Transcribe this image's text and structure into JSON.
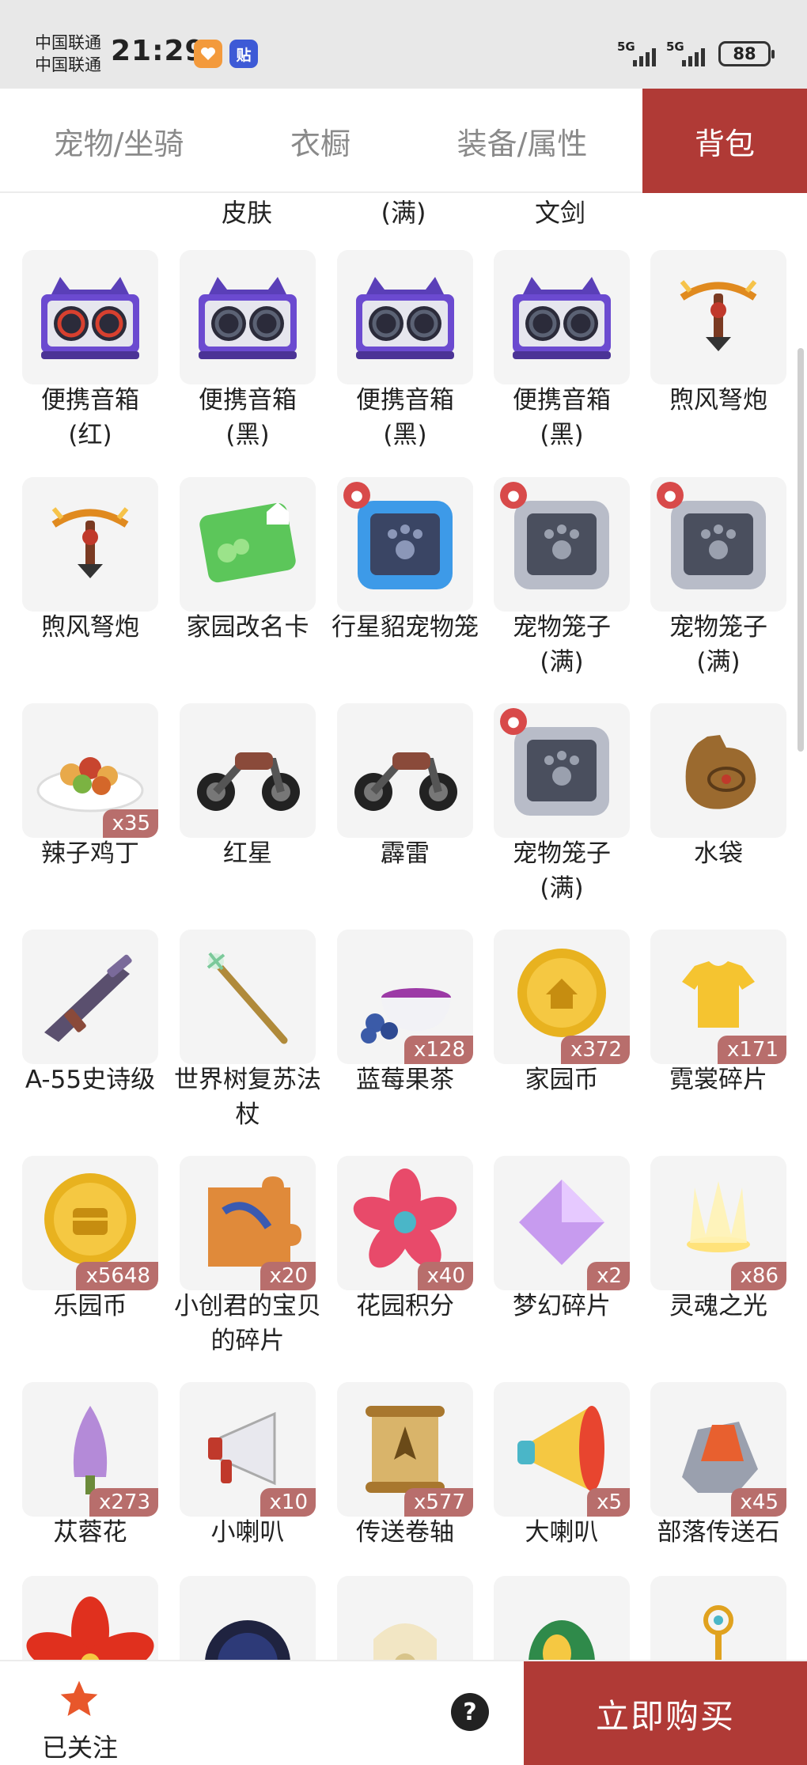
{
  "status_bar": {
    "carrier_1": "中国联通",
    "carrier_2": "中国联通",
    "time": "21:29",
    "app_badge_2": "贴",
    "signal_1": "5G",
    "signal_2": "5G",
    "battery": "88"
  },
  "tabs": [
    {
      "label": "宠物/坐骑",
      "active": false
    },
    {
      "label": "衣橱",
      "active": false
    },
    {
      "label": "装备/属性",
      "active": false
    },
    {
      "label": "背包",
      "active": true
    }
  ],
  "partial_labels": [
    "皮肤",
    "(满)",
    "文剑"
  ],
  "items": [
    {
      "name": "便携音箱\n(红)",
      "qty": "",
      "icon": "speaker-red-icon"
    },
    {
      "name": "便携音箱\n(黑)",
      "qty": "",
      "icon": "speaker-black-icon"
    },
    {
      "name": "便携音箱\n(黑)",
      "qty": "",
      "icon": "speaker-black-icon"
    },
    {
      "name": "便携音箱\n(黑)",
      "qty": "",
      "icon": "speaker-black-icon"
    },
    {
      "name": "煦风弩炮",
      "qty": "",
      "icon": "crossbow-icon"
    },
    {
      "name": "煦风弩炮",
      "qty": "",
      "icon": "crossbow-icon"
    },
    {
      "name": "家园改名卡",
      "qty": "",
      "icon": "rename-card-icon"
    },
    {
      "name": "行星貂宠物笼",
      "qty": "",
      "icon": "pet-cage-blue-icon"
    },
    {
      "name": "宠物笼子\n(满)",
      "qty": "",
      "icon": "pet-cage-grey-icon"
    },
    {
      "name": "宠物笼子\n(满)",
      "qty": "",
      "icon": "pet-cage-grey-icon"
    },
    {
      "name": "辣子鸡丁",
      "qty": "x35",
      "icon": "dish-icon"
    },
    {
      "name": "红星",
      "qty": "",
      "icon": "motorcycle-icon"
    },
    {
      "name": "霹雷",
      "qty": "",
      "icon": "motorcycle-icon"
    },
    {
      "name": "宠物笼子\n(满)",
      "qty": "",
      "icon": "pet-cage-grey-icon"
    },
    {
      "name": "水袋",
      "qty": "",
      "icon": "water-bag-icon"
    },
    {
      "name": "A-55史诗级",
      "qty": "",
      "icon": "rifle-icon"
    },
    {
      "name": "世界树复苏法杖",
      "qty": "",
      "icon": "staff-icon"
    },
    {
      "name": "蓝莓果茶",
      "qty": "x128",
      "icon": "tea-cup-icon"
    },
    {
      "name": "家园币",
      "qty": "x372",
      "icon": "home-coin-icon"
    },
    {
      "name": "霓裳碎片",
      "qty": "x171",
      "icon": "shirt-shard-icon"
    },
    {
      "name": "乐园币",
      "qty": "x5648",
      "icon": "park-coin-icon"
    },
    {
      "name": "小创君的宝贝的碎片",
      "qty": "x20",
      "icon": "puzzle-piece-icon"
    },
    {
      "name": "花园积分",
      "qty": "x40",
      "icon": "flower-badge-icon"
    },
    {
      "name": "梦幻碎片",
      "qty": "x2",
      "icon": "dream-puzzle-icon"
    },
    {
      "name": "灵魂之光",
      "qty": "x86",
      "icon": "soul-light-icon"
    },
    {
      "name": "苁蓉花",
      "qty": "x273",
      "icon": "flower-spike-icon"
    },
    {
      "name": "小喇叭",
      "qty": "x10",
      "icon": "megaphone-small-icon"
    },
    {
      "name": "传送卷轴",
      "qty": "x577",
      "icon": "scroll-icon"
    },
    {
      "name": "大喇叭",
      "qty": "x5",
      "icon": "megaphone-big-icon"
    },
    {
      "name": "部落传送石",
      "qty": "x45",
      "icon": "teleport-stone-icon"
    },
    {
      "name": "",
      "qty": "",
      "icon": "red-flower-icon"
    },
    {
      "name": "",
      "qty": "",
      "icon": "dark-orb-icon"
    },
    {
      "name": "",
      "qty": "",
      "icon": "mask-icon"
    },
    {
      "name": "",
      "qty": "",
      "icon": "green-egg-icon"
    },
    {
      "name": "",
      "qty": "",
      "icon": "key-icon"
    }
  ],
  "bottom_bar": {
    "follow_label": "已关注",
    "help_label": "?",
    "buy_label": "立即购买"
  },
  "colors": {
    "accent": "#b03a36",
    "qty_badge": "#b86e6c",
    "tile_bg": "#f4f4f4"
  }
}
